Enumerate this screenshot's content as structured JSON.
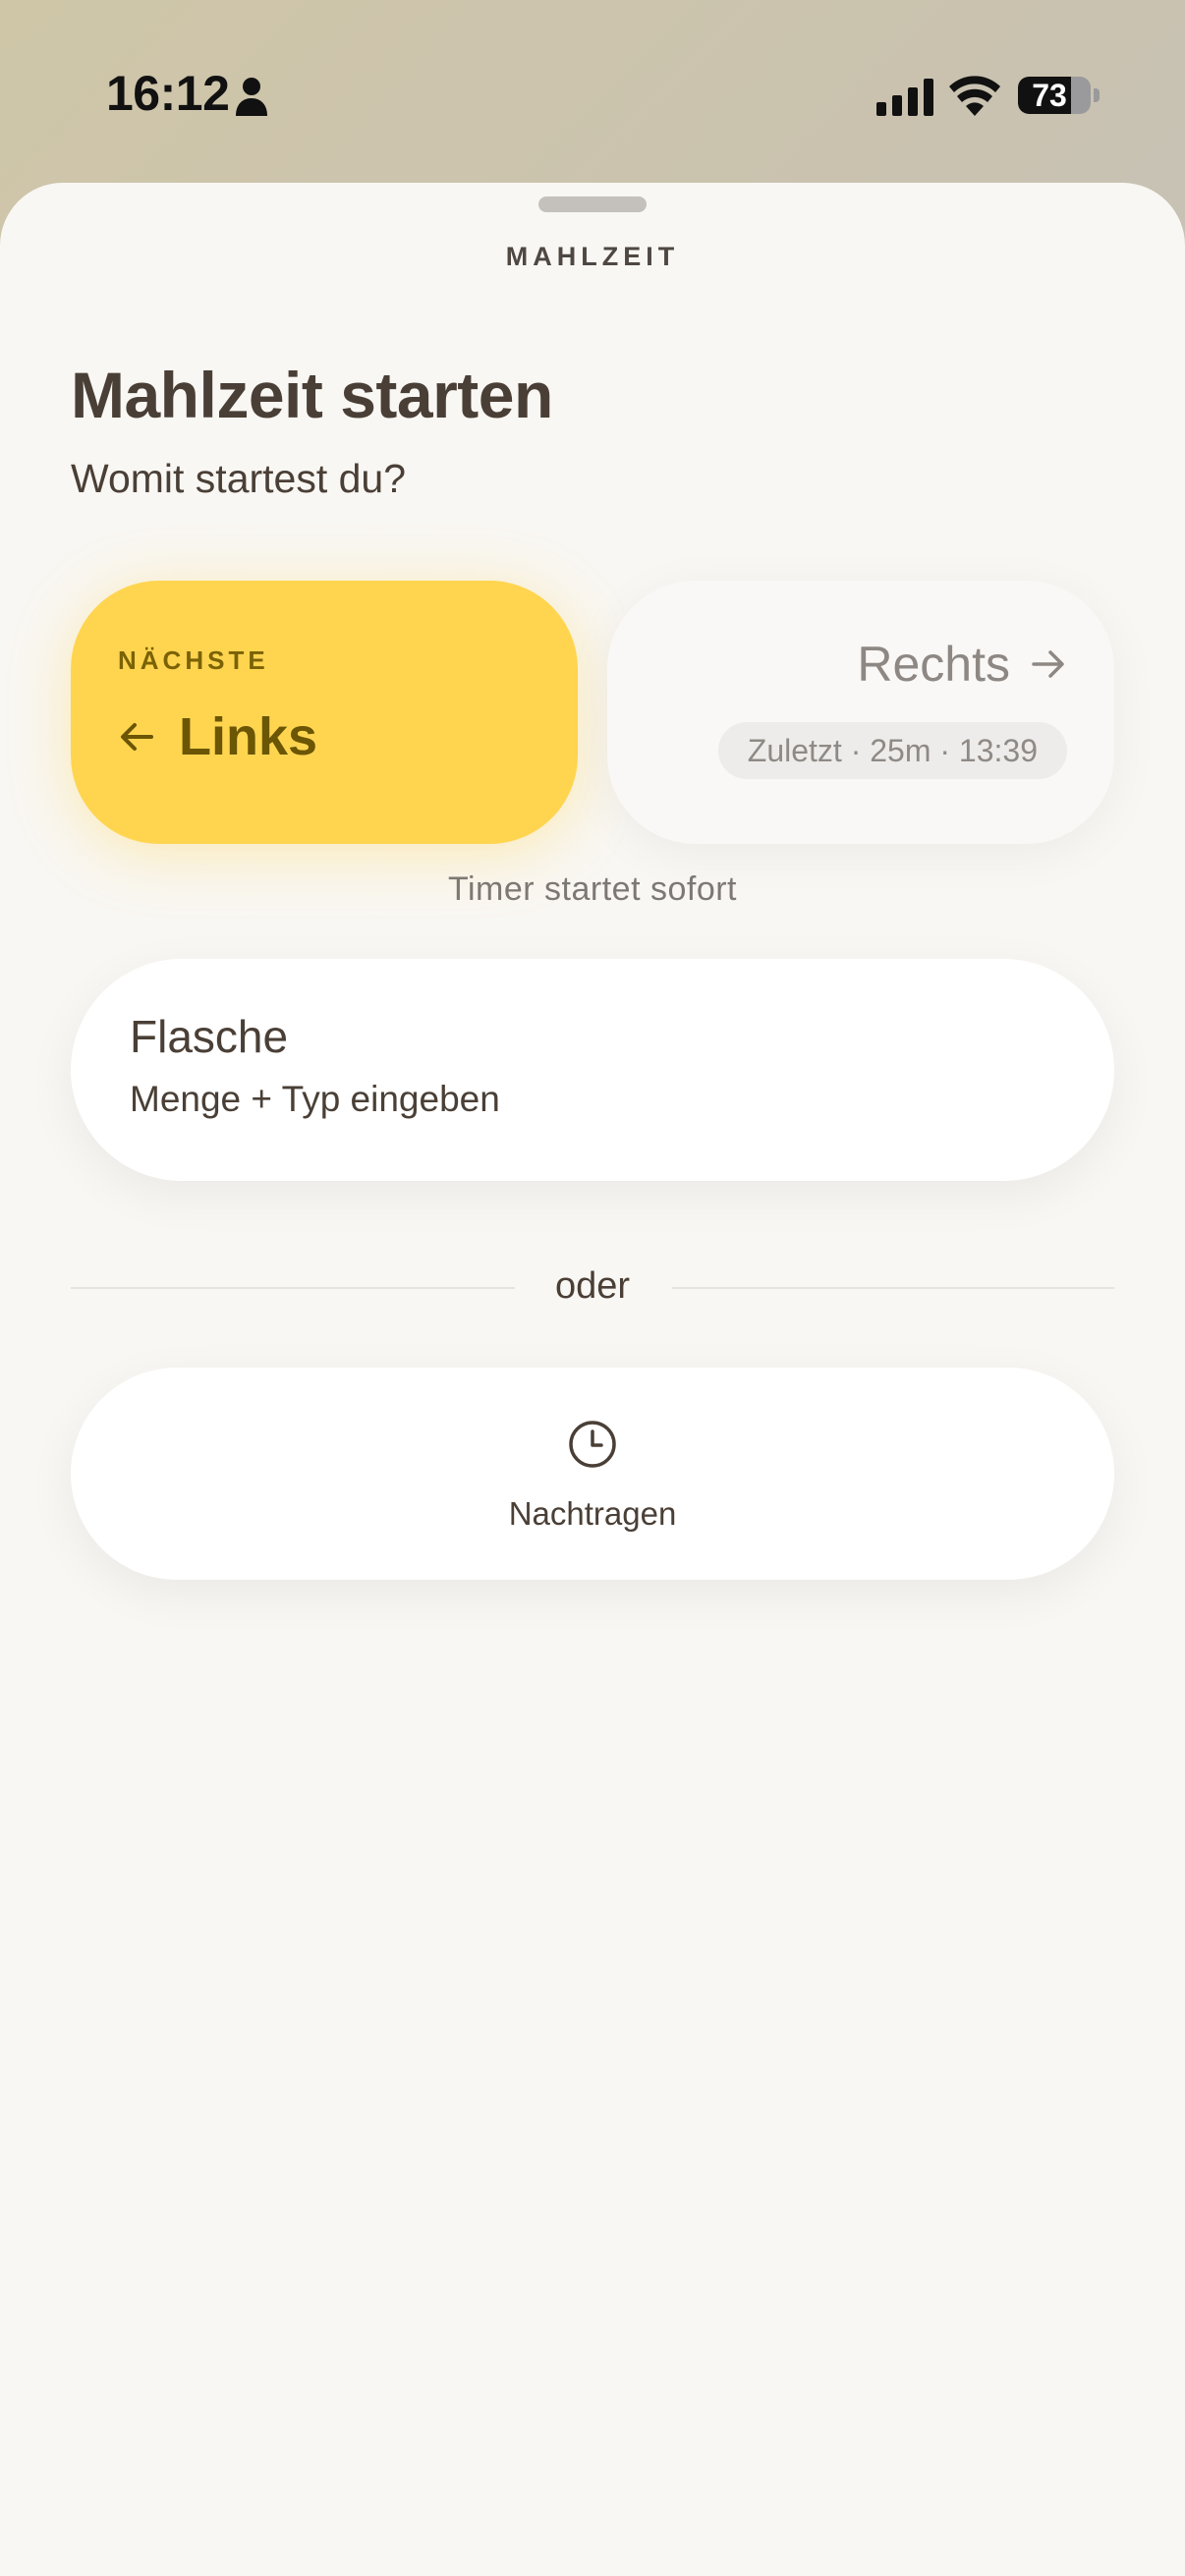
{
  "status_bar": {
    "time": "16:12",
    "battery_percent": "73",
    "battery_level": 0.73,
    "icons": [
      "person-icon",
      "cellular-signal-icon",
      "wifi-icon",
      "battery-icon"
    ]
  },
  "sheet": {
    "label": "MAHLZEIT",
    "title": "Mahlzeit starten",
    "subtitle": "Womit startest du?"
  },
  "sides": {
    "left": {
      "badge": "NÄCHSTE",
      "label": "Links",
      "icon": "arrow-left-icon",
      "color": "#ffd54f"
    },
    "right": {
      "label": "Rechts",
      "icon": "arrow-right-icon",
      "last": "Zuletzt · 25m · 13:39"
    },
    "hint": "Timer startet sofort"
  },
  "bottle": {
    "title": "Flasche",
    "subtitle": "Menge + Typ eingeben"
  },
  "divider": {
    "text": "oder"
  },
  "backfill": {
    "label": "Nachtragen",
    "icon": "clock-icon"
  }
}
